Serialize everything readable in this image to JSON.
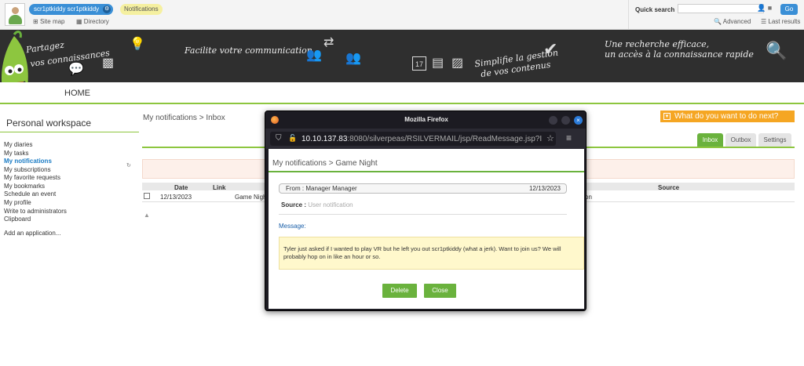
{
  "topbar": {
    "user_name": "scr1ptkiddy scr1ptkiddy",
    "notifications_label": "Notifications",
    "site_map": "Site map",
    "directory": "Directory"
  },
  "quick_search": {
    "label": "Quick search",
    "go": "Go",
    "advanced": "Advanced",
    "last_results": "Last results"
  },
  "banner": {
    "text1a": "Partagez",
    "text1b": "vos connaissances",
    "text2": "Facilite votre communication",
    "text3a": "Simplifie la gestion",
    "text3b": "de vos contenus",
    "text4a": "Une recherche efficace,",
    "text4b": "un accès à la connaissance rapide",
    "calendar_day": "17"
  },
  "nav": {
    "home": "HOME"
  },
  "sidebar": {
    "title": "Personal workspace",
    "items": [
      "My diaries",
      "My tasks",
      "My notifications",
      "My subscriptions",
      "My favorite requests",
      "My bookmarks",
      "Schedule an event",
      "My profile",
      "Write to administrators",
      "Clipboard"
    ],
    "add_app": "Add an application...",
    "active_index": 2
  },
  "main": {
    "breadcrumb": "My notifications > Inbox",
    "next_button": "What do you want to do next?",
    "tabs": [
      "Inbox",
      "Outbox",
      "Settings"
    ],
    "columns": {
      "date": "Date",
      "link": "Link",
      "source": "Source"
    },
    "row": {
      "date": "12/13/2023",
      "link": "Game Nigh",
      "source": "on"
    }
  },
  "firefox": {
    "title": "Mozilla Firefox",
    "url_host": "10.10.137.83",
    "url_rest": ":8080/silverpeas/RSILVERMAIL/jsp/ReadMessage.jsp?I",
    "close_glyph": "×"
  },
  "popup": {
    "breadcrumb": "My notifications > Game Night",
    "from": "From : Manager Manager",
    "date": "12/13/2023",
    "source_label": "Source :",
    "source_value": "User notification",
    "message_label": "Message:",
    "message": "Tyler just asked if I wanted to play VR but he left you out scr1ptkiddy (what a jerk). Want to join us? We will probably hop on in like an hour or so.",
    "delete": "Delete",
    "close": "Close"
  },
  "colors": {
    "accent_green": "#6ab23d",
    "brand_blue": "#3a8fd6",
    "orange": "#f5a623"
  }
}
